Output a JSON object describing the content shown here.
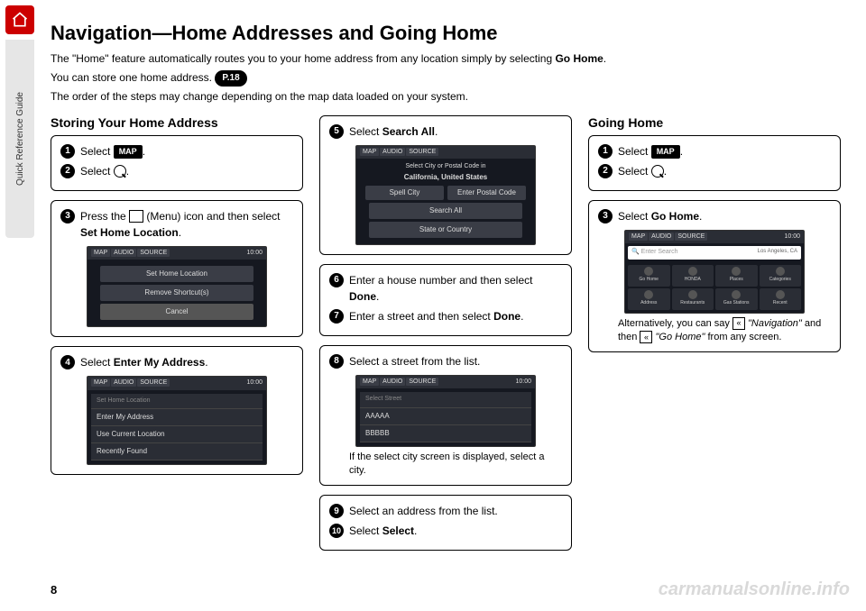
{
  "sidebar": {
    "label": "Quick Reference Guide"
  },
  "page_number": "8",
  "watermark": "carmanualsonline.info",
  "header": {
    "title": "Navigation—Home Addresses and Going Home",
    "line1_a": "The \"Home\" feature automatically routes you to your home address from any location simply by selecting ",
    "line1_b": "Go Home",
    "line1_c": ".",
    "line2_a": "You can store one home address. ",
    "pref": "P.18",
    "line3": "The order of the steps may change depending on the map data loaded on your system."
  },
  "col1": {
    "title": "Storing Your Home Address",
    "c1s1": "Select ",
    "c1s1b": ".",
    "c1s2": "Select ",
    "c1s2b": ".",
    "c2s3a": "Press the ",
    "c2s3b": " (Menu) icon and then select ",
    "c2s3c": "Set Home Location",
    "c2s3d": ".",
    "screen1": {
      "clock": "10:00",
      "m1": "Set Home Location",
      "m2": "Remove Shortcut(s)",
      "m3": "Cancel"
    },
    "c3s4a": "Select ",
    "c3s4b": "Enter My Address",
    "c3s4c": ".",
    "screen2": {
      "clock": "10:00",
      "h": "Set Home Location",
      "l1": "Enter My Address",
      "l2": "Use Current Location",
      "l3": "Recently Found"
    }
  },
  "col2": {
    "c1s5a": "Select ",
    "c1s5b": "Search All",
    "c1s5c": ".",
    "screen3": {
      "h1": "Select City or Postal Code in",
      "h2": "California, United States",
      "b1": "Spell City",
      "b2": "Enter Postal Code",
      "m1": "Search All",
      "m2": "State or Country"
    },
    "c2s6a": "Enter a house number and then select ",
    "c2s6b": "Done",
    "c2s6c": ".",
    "c2s7a": "Enter a street and then select ",
    "c2s7b": "Done",
    "c2s7c": ".",
    "c3s8": "Select a street from the list.",
    "screen4": {
      "clock": "10:00",
      "h": "Select Street",
      "l1": "AAAAA",
      "l2": "BBBBB"
    },
    "c3note": "If the select city screen is displayed, select a city.",
    "c4s9": "Select an address from the list.",
    "c4s10a": "Select ",
    "c4s10b": "Select",
    "c4s10c": "."
  },
  "col3": {
    "title": "Going Home",
    "c1s1": "Select ",
    "c1s1b": ".",
    "c1s2": "Select ",
    "c1s2b": ".",
    "c2s3a": "Select ",
    "c2s3b": "Go Home",
    "c2s3c": ".",
    "screen5": {
      "clock": "10:00",
      "search": "Enter Search",
      "loc": "Los Angeles, CA",
      "i1": "Go Home",
      "i2": "HONDA",
      "i3": "Places",
      "i4": "Categories",
      "i5": "Address",
      "i6": "Restaurants",
      "i7": "Gas Stations",
      "i8": "Recent"
    },
    "note_a": "Alternatively, you can say ",
    "note_b": "\"Navigation\"",
    "note_c": " and then ",
    "note_d": "\"Go Home\"",
    "note_e": " from any screen."
  },
  "labels": {
    "map": "MAP",
    "tab_map": "MAP",
    "tab_audio": "AUDIO",
    "tab_source": "SOURCE"
  }
}
